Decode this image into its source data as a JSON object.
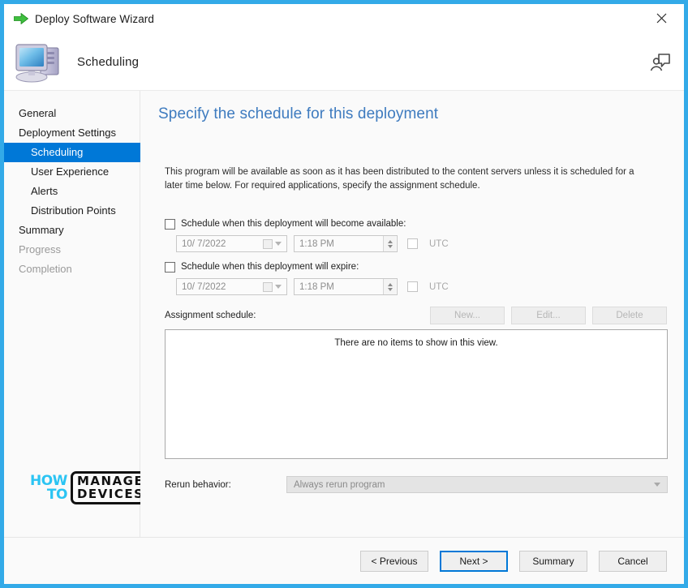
{
  "window": {
    "title": "Deploy Software Wizard",
    "title_icon": "green-arrow-icon",
    "close_icon": "close-icon",
    "border_color": "#33AAE8"
  },
  "header": {
    "title": "Scheduling",
    "icon": "computer-icon",
    "feedback_icon": "feedback-person-icon"
  },
  "sidebar": {
    "items": [
      {
        "label": "General",
        "level": "top",
        "state": "normal"
      },
      {
        "label": "Deployment Settings",
        "level": "top",
        "state": "normal"
      },
      {
        "label": "Scheduling",
        "level": "sub",
        "state": "selected"
      },
      {
        "label": "User Experience",
        "level": "sub",
        "state": "normal"
      },
      {
        "label": "Alerts",
        "level": "sub",
        "state": "normal"
      },
      {
        "label": "Distribution Points",
        "level": "sub",
        "state": "normal"
      },
      {
        "label": "Summary",
        "level": "top",
        "state": "normal"
      },
      {
        "label": "Progress",
        "level": "top",
        "state": "disabled"
      },
      {
        "label": "Completion",
        "level": "top",
        "state": "disabled"
      }
    ],
    "selected_color": "#0078D7"
  },
  "main": {
    "heading": "Specify the schedule for this deployment",
    "heading_color": "#3E7BBF",
    "description": "This program will be available as soon as it has been distributed to the content servers unless it is scheduled for a later time below. For required applications, specify the assignment schedule.",
    "available": {
      "checkbox_label": "Schedule when this deployment will become available:",
      "checked": false,
      "date_value": "10/ 7/2022",
      "time_value": "1:18 PM",
      "utc_label": "UTC",
      "utc_checked": false
    },
    "expire": {
      "checkbox_label": "Schedule when this deployment will expire:",
      "checked": false,
      "date_value": "10/ 7/2022",
      "time_value": "1:18 PM",
      "utc_label": "UTC",
      "utc_checked": false
    },
    "assignment": {
      "label": "Assignment schedule:",
      "new_button": "New...",
      "edit_button": "Edit...",
      "delete_button": "Delete",
      "empty_message": "There are no items to show in this view."
    },
    "rerun": {
      "label": "Rerun behavior:",
      "value": "Always rerun program"
    }
  },
  "watermark": {
    "how": "HOW",
    "to": "TO",
    "manage": "MANAGE",
    "devices": "DEVICES",
    "accent_color": "#2BC4F3"
  },
  "footer": {
    "previous": "< Previous",
    "next": "Next >",
    "summary": "Summary",
    "cancel": "Cancel"
  }
}
